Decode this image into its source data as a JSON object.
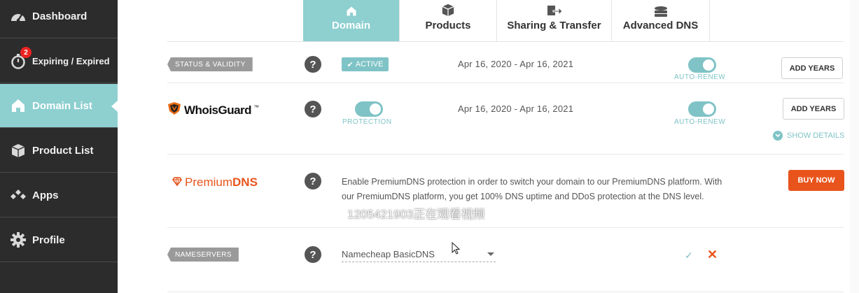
{
  "sidebar": {
    "items": [
      {
        "label": "Dashboard",
        "icon": "dashboard-gauge-icon"
      },
      {
        "label": "Expiring / Expired",
        "icon": "stopwatch-icon",
        "badge": "2"
      },
      {
        "label": "Domain List",
        "icon": "home-icon",
        "active": true
      },
      {
        "label": "Product List",
        "icon": "box-icon"
      },
      {
        "label": "Apps",
        "icon": "apps-diamonds-icon"
      },
      {
        "label": "Profile",
        "icon": "gear-icon"
      }
    ]
  },
  "tabs": [
    {
      "label": "Domain",
      "icon": "home-icon",
      "active": true
    },
    {
      "label": "Products",
      "icon": "box-icon"
    },
    {
      "label": "Sharing & Transfer",
      "icon": "transfer-icon"
    },
    {
      "label": "Advanced DNS",
      "icon": "server-icon"
    }
  ],
  "status_row": {
    "tag": "STATUS & VALIDITY",
    "status": "ACTIVE",
    "dates": "Apr 16, 2020 - Apr 16, 2021",
    "toggle_label": "AUTO-RENEW",
    "auto_renew": true,
    "button": "ADD YEARS"
  },
  "whoisguard_row": {
    "logo_text": "WhoisGuard",
    "trademark": "™",
    "protection_label": "PROTECTION",
    "protection": true,
    "dates": "Apr 16, 2020 - Apr 16, 2021",
    "toggle_label": "AUTO-RENEW",
    "auto_renew": true,
    "button": "ADD YEARS",
    "show_details": "SHOW DETAILS"
  },
  "premiumdns_row": {
    "logo_prefix": "Premium",
    "logo_suffix": "DNS",
    "description": "Enable PremiumDNS protection in order to switch your domain to our PremiumDNS platform. With our PremiumDNS platform, you get 100% DNS uptime and DDoS protection at the DNS level.",
    "button": "BUY NOW"
  },
  "nameservers_row": {
    "tag": "NAMESERVERS",
    "selected": "Namecheap BasicDNS",
    "confirm": "✓",
    "cancel": "✕"
  },
  "overlay_text": "1205421903正在观看视频",
  "colors": {
    "accent": "#8ecfd0",
    "orange": "#e8541c",
    "sidebar_bg": "#2c2c2c",
    "badge_red": "#ee2222"
  }
}
